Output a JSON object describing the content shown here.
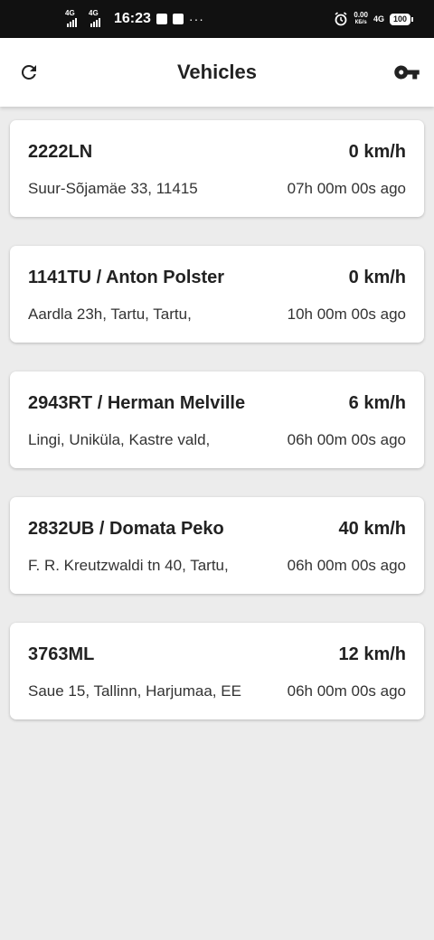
{
  "status_bar": {
    "network_1": "4G",
    "network_2": "4G",
    "time": "16:23",
    "more": "···",
    "data_speed_value": "0.00",
    "data_speed_unit": "КБ/s",
    "network_3": "4G",
    "battery": "100"
  },
  "app_bar": {
    "title": "Vehicles",
    "refresh_icon": "refresh-icon",
    "key_icon": "key-icon"
  },
  "vehicles": [
    {
      "name": "2222LN",
      "speed": "0 km/h",
      "address": "Suur-Sõjamäe 33, 11415",
      "last_update": "07h 00m 00s ago"
    },
    {
      "name": "1141TU / Anton Polster",
      "speed": "0 km/h",
      "address": "Aardla 23h, Tartu, Tartu,",
      "last_update": "10h 00m 00s ago"
    },
    {
      "name": "2943RT / Herman Melville",
      "speed": "6 km/h",
      "address": "Lingi, Uniküla, Kastre vald,",
      "last_update": "06h 00m 00s ago"
    },
    {
      "name": "2832UB / Domata Peko",
      "speed": "40 km/h",
      "address": "F. R. Kreutzwaldi tn 40, Tartu,",
      "last_update": "06h 00m 00s ago"
    },
    {
      "name": "3763ML",
      "speed": "12 km/h",
      "address": "Saue 15, Tallinn, Harjumaa, EE",
      "last_update": "06h 00m 00s ago"
    }
  ]
}
